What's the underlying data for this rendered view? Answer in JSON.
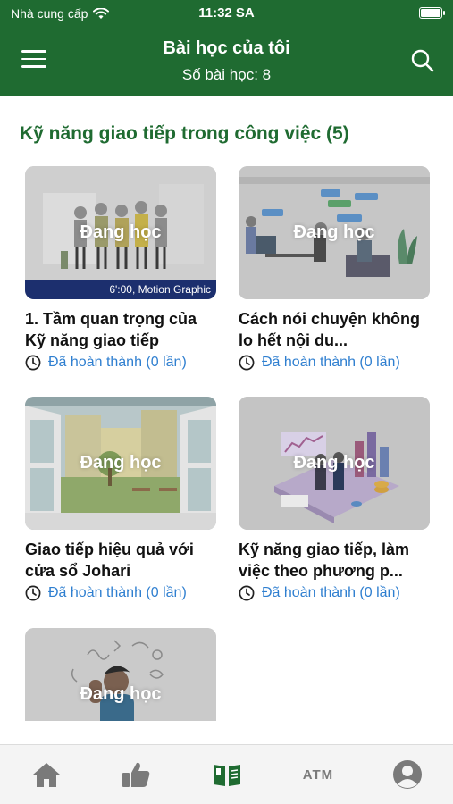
{
  "status_bar": {
    "carrier": "Nhà cung cấp",
    "time": "11:32 SA"
  },
  "header": {
    "title": "Bài học của tôi",
    "subtitle": "Số bài học: 8"
  },
  "section": {
    "title": "Kỹ năng giao tiếp trong công việc (5)"
  },
  "courses": [
    {
      "overlay": "Đang học",
      "caption": "6':00, Motion Graphic",
      "title": "1. Tầm quan trọng của Kỹ năng giao tiếp",
      "status": "Đã hoàn thành (0 lần)"
    },
    {
      "overlay": "Đang học",
      "title": "Cách nói chuyện không lo hết nội du...",
      "status": "Đã hoàn thành (0 lần)"
    },
    {
      "overlay": "Đang học",
      "title": "Giao tiếp hiệu quả với cửa sổ Johari",
      "status": "Đã hoàn thành (0 lần)"
    },
    {
      "overlay": "Đang học",
      "title": "Kỹ năng giao tiếp, làm việc theo phương p...",
      "status": "Đã hoàn thành (0 lần)"
    },
    {
      "overlay": "Đang học"
    }
  ],
  "tabbar": {
    "atm_label": "ATM",
    "active_tab": "my-lessons",
    "active_color": "#1f6b31",
    "inactive_color": "#7a7a7a"
  },
  "colors": {
    "brand": "#1f6b31",
    "link": "#2f7fd0"
  }
}
